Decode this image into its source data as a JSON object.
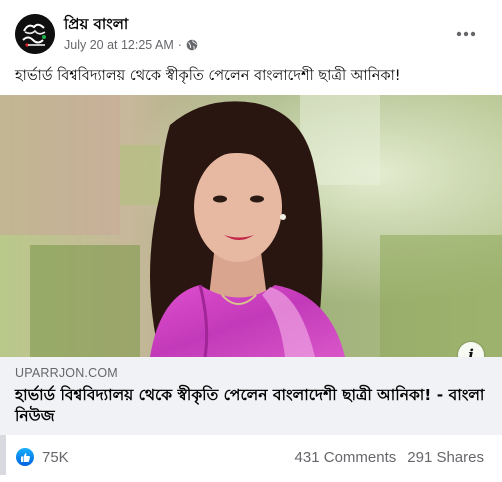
{
  "post": {
    "page_name": "প্রিয় বাংলা",
    "avatar_logo": "প্রিয় বাংলা",
    "date": "July 20 at 12:25 AM",
    "separator": "·",
    "privacy_icon": "globe-icon",
    "more_icon": "more-horizontal-icon",
    "caption": "হার্ভার্ড বিশ্ববিদ্যালয় থেকে স্বীকৃতি পেলেন বাংলাদেশী ছাত্রী আনিকা!"
  },
  "link_preview": {
    "domain": "UPARRJON.COM",
    "title": "হার্ভার্ড বিশ্ববিদ্যালয় থেকে স্বীকৃতি পেলেন বাংলাদেশী ছাত্রী আনিকা! - বাংলা নিউজ",
    "info_icon": "info-icon",
    "info_label": "i"
  },
  "footer": {
    "reaction_icon": "like-icon",
    "reactions": "75K",
    "comments": "431 Comments",
    "shares": "291 Shares"
  },
  "colors": {
    "secondary_text": "#65676b",
    "link_box_bg": "#f0f2f5",
    "like_blue": "#1877f2",
    "saree_pink": "#d63fc9"
  }
}
